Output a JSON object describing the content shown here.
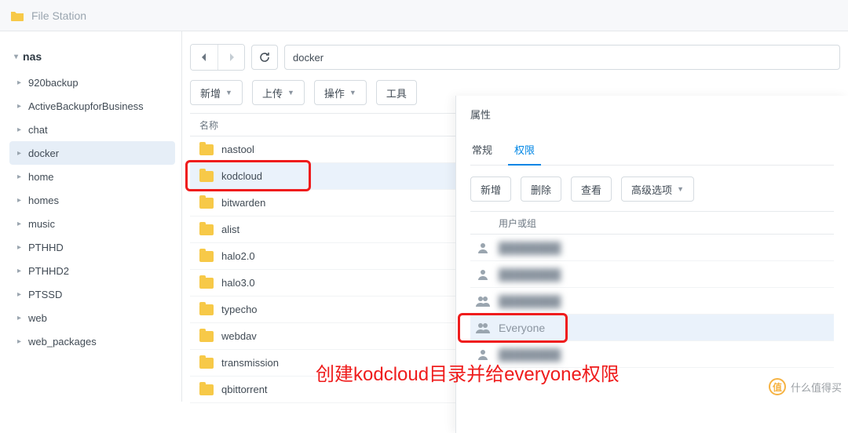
{
  "app": {
    "title": "File Station"
  },
  "sidebar": {
    "root": "nas",
    "items": [
      {
        "label": "920backup"
      },
      {
        "label": "ActiveBackupforBusiness"
      },
      {
        "label": "chat"
      },
      {
        "label": "docker",
        "selected": true
      },
      {
        "label": "home"
      },
      {
        "label": "homes"
      },
      {
        "label": "music"
      },
      {
        "label": "PTHHD"
      },
      {
        "label": "PTHHD2"
      },
      {
        "label": "PTSSD"
      },
      {
        "label": "web"
      },
      {
        "label": "web_packages"
      }
    ]
  },
  "path": {
    "value": "docker"
  },
  "actions": {
    "new": "新增",
    "upload": "上传",
    "operate": "操作",
    "tools": "工具"
  },
  "list": {
    "header_name": "名称",
    "rows": [
      {
        "name": "nastool"
      },
      {
        "name": "kodcloud",
        "selected": true,
        "highlight": true
      },
      {
        "name": "bitwarden"
      },
      {
        "name": "alist"
      },
      {
        "name": "halo2.0"
      },
      {
        "name": "halo3.0"
      },
      {
        "name": "typecho"
      },
      {
        "name": "webdav"
      },
      {
        "name": "transmission"
      },
      {
        "name": "qbittorrent"
      }
    ]
  },
  "panel": {
    "title": "属性",
    "tabs": {
      "general": "常规",
      "permission": "权限"
    },
    "buttons": {
      "new": "新增",
      "delete": "删除",
      "view": "查看",
      "advanced": "高级选项"
    },
    "perm_header": "用户或组",
    "rows": [
      {
        "type": "user",
        "label": ""
      },
      {
        "type": "user",
        "label": ""
      },
      {
        "type": "group",
        "label": ""
      },
      {
        "type": "group",
        "label": "Everyone",
        "selected": true,
        "highlight": true
      },
      {
        "type": "user",
        "label": ""
      }
    ]
  },
  "annotation": "创建kodcloud目录并给everyone权限",
  "watermark": "什么值得买"
}
